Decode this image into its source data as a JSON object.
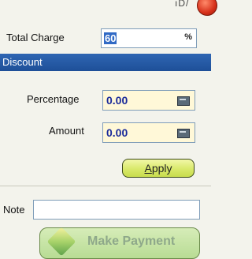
{
  "top": {
    "cut_text": "ıD/"
  },
  "total_charge": {
    "label": "Total Charge",
    "value": "60",
    "icon": "percent-icon",
    "icon_text": "%"
  },
  "discount": {
    "title": "Discount",
    "percentage": {
      "label": "Percentage",
      "value": "0.00",
      "icon": "calculator-icon"
    },
    "amount": {
      "label": "Amount",
      "value": "0.00",
      "icon": "calculator-icon"
    },
    "apply": {
      "label_underlined": "A",
      "label_rest": "pply"
    }
  },
  "note": {
    "label": "Note",
    "value": ""
  },
  "make_payment": {
    "label": "Make Payment",
    "icon": "payment-icon"
  }
}
